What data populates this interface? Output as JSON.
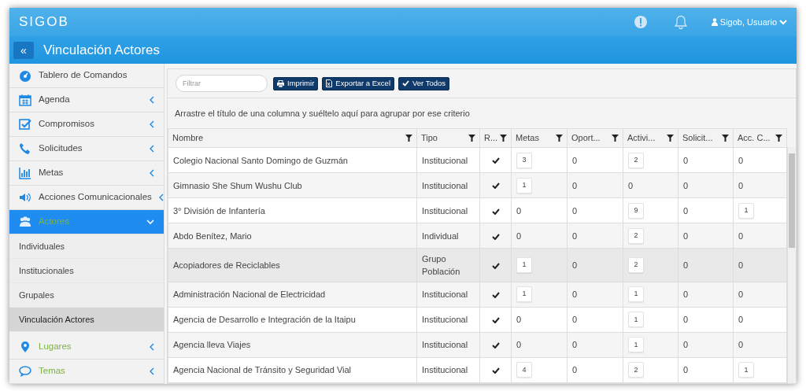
{
  "app": {
    "brand": "SIGOB",
    "user": "Sigob, Usuario",
    "page_title": "Vinculación Actores",
    "collapse_glyph": "«"
  },
  "sidebar": {
    "items": [
      {
        "label": "Tablero de Comandos",
        "color": "#444444",
        "chevron": false,
        "expanded": false,
        "selected": false
      },
      {
        "label": "Agenda",
        "color": "#444444",
        "chevron": true,
        "expanded": false,
        "selected": false
      },
      {
        "label": "Compromisos",
        "color": "#444444",
        "chevron": true,
        "expanded": false,
        "selected": false
      },
      {
        "label": "Solicitudes",
        "color": "#444444",
        "chevron": true,
        "expanded": false,
        "selected": false
      },
      {
        "label": "Metas",
        "color": "#444444",
        "chevron": true,
        "expanded": false,
        "selected": false
      },
      {
        "label": "Acciones Comunicacionales",
        "color": "#444444",
        "chevron": true,
        "expanded": false,
        "selected": false
      },
      {
        "label": "Actores",
        "color": "#7cb342",
        "chevron": true,
        "expanded": true,
        "selected": true,
        "children": [
          {
            "label": "Individuales",
            "selected": false
          },
          {
            "label": "Institucionales",
            "selected": false
          },
          {
            "label": "Grupales",
            "selected": false
          },
          {
            "label": "Vinculación Actores",
            "selected": true
          }
        ]
      },
      {
        "label": "Lugares",
        "color": "#7cb342",
        "chevron": true,
        "expanded": false,
        "selected": false
      },
      {
        "label": "Temas",
        "color": "#7cb342",
        "chevron": true,
        "expanded": false,
        "selected": false
      }
    ]
  },
  "toolbar": {
    "filter": {
      "placeholder": "Filtrar"
    },
    "buttons": [
      "Imprimir",
      "Exportar a Excel",
      "Ver Todos"
    ]
  },
  "group_hint": "Arrastre el título de una columna y suéltelo aquí para agrupar por ese criterio",
  "table": {
    "columns": [
      "Nombre",
      "Tipo",
      "R...",
      "Metas",
      "Oport...",
      "Activi...",
      "Solicit...",
      "Acc. C..."
    ],
    "rows": [
      {
        "nombre": "Colegio Nacional Santo Domingo de Guzmán",
        "tipo": "Institucional",
        "checked": true,
        "selected": false,
        "counts": [
          {
            "value": "3",
            "boxed": true
          },
          {
            "value": "0",
            "boxed": false
          },
          {
            "value": "2",
            "boxed": true
          },
          {
            "value": "0",
            "boxed": false
          },
          {
            "value": "0",
            "boxed": false
          }
        ]
      },
      {
        "nombre": "Gimnasio She Shum Wushu Club",
        "tipo": "Institucional",
        "checked": true,
        "selected": false,
        "counts": [
          {
            "value": "1",
            "boxed": true
          },
          {
            "value": "0",
            "boxed": false
          },
          {
            "value": "0",
            "boxed": false
          },
          {
            "value": "0",
            "boxed": false
          },
          {
            "value": "0",
            "boxed": false
          }
        ]
      },
      {
        "nombre": "3° División de Infantería",
        "tipo": "Institucional",
        "checked": true,
        "selected": false,
        "counts": [
          {
            "value": "0",
            "boxed": false
          },
          {
            "value": "0",
            "boxed": false
          },
          {
            "value": "9",
            "boxed": true
          },
          {
            "value": "0",
            "boxed": false
          },
          {
            "value": "1",
            "boxed": true
          }
        ]
      },
      {
        "nombre": "Abdo Benítez, Mario",
        "tipo": "Individual",
        "checked": true,
        "selected": false,
        "counts": [
          {
            "value": "0",
            "boxed": false
          },
          {
            "value": "0",
            "boxed": false
          },
          {
            "value": "2",
            "boxed": true
          },
          {
            "value": "0",
            "boxed": false
          },
          {
            "value": "0",
            "boxed": false
          }
        ]
      },
      {
        "nombre": "Acopiadores de Reciclables",
        "tipo": "Grupo Población",
        "checked": true,
        "selected": true,
        "counts": [
          {
            "value": "1",
            "boxed": true
          },
          {
            "value": "0",
            "boxed": false
          },
          {
            "value": "2",
            "boxed": true
          },
          {
            "value": "0",
            "boxed": false
          },
          {
            "value": "0",
            "boxed": false
          }
        ]
      },
      {
        "nombre": "Administración Nacional de Electricidad",
        "tipo": "Institucional",
        "checked": true,
        "selected": false,
        "counts": [
          {
            "value": "1",
            "boxed": true
          },
          {
            "value": "0",
            "boxed": false
          },
          {
            "value": "1",
            "boxed": true
          },
          {
            "value": "0",
            "boxed": false
          },
          {
            "value": "0",
            "boxed": false
          }
        ]
      },
      {
        "nombre": "Agencia de Desarrollo e Integración de la Itaipu",
        "tipo": "Institucional",
        "checked": true,
        "selected": false,
        "counts": [
          {
            "value": "0",
            "boxed": false
          },
          {
            "value": "0",
            "boxed": false
          },
          {
            "value": "1",
            "boxed": true
          },
          {
            "value": "0",
            "boxed": false
          },
          {
            "value": "0",
            "boxed": false
          }
        ]
      },
      {
        "nombre": "Agencia lleva Viajes",
        "tipo": "Institucional",
        "checked": true,
        "selected": false,
        "counts": [
          {
            "value": "0",
            "boxed": false
          },
          {
            "value": "0",
            "boxed": false
          },
          {
            "value": "1",
            "boxed": true
          },
          {
            "value": "0",
            "boxed": false
          },
          {
            "value": "0",
            "boxed": false
          }
        ]
      },
      {
        "nombre": "Agencia Nacional de Tránsito y Seguridad Vial",
        "tipo": "Institucional",
        "checked": true,
        "selected": false,
        "counts": [
          {
            "value": "4",
            "boxed": true
          },
          {
            "value": "0",
            "boxed": false
          },
          {
            "value": "2",
            "boxed": true
          },
          {
            "value": "0",
            "boxed": false
          },
          {
            "value": "1",
            "boxed": true
          }
        ]
      }
    ]
  }
}
